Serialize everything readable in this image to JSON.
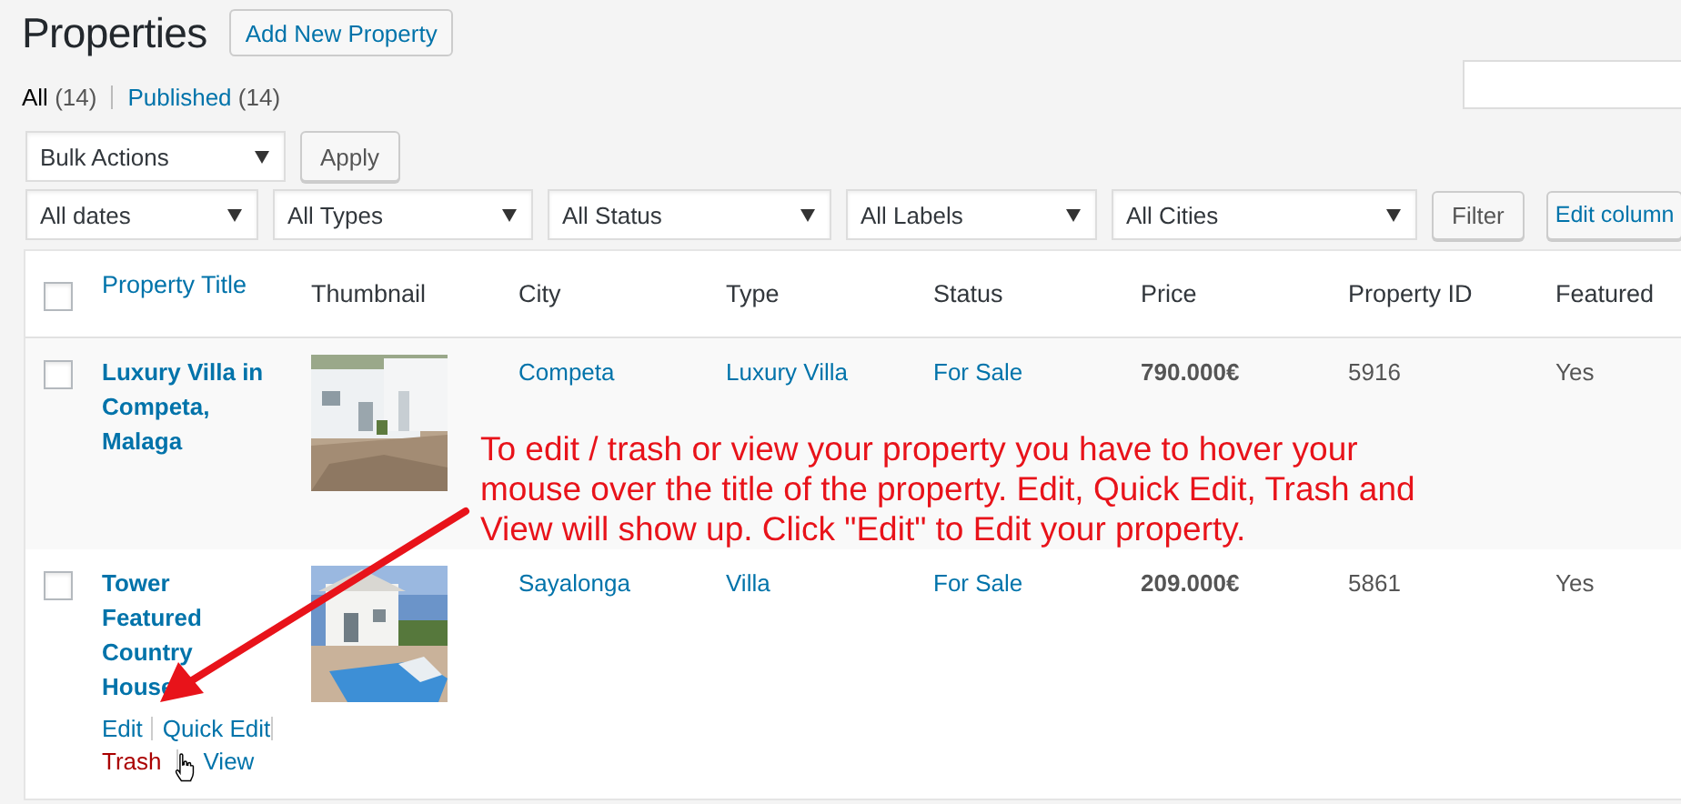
{
  "page": {
    "title": "Properties",
    "add_button": "Add New Property"
  },
  "views": [
    {
      "label": "All",
      "count": "(14)",
      "selected": true
    },
    {
      "label": "Published",
      "count": "(14)",
      "selected": false
    }
  ],
  "bulk_actions": {
    "value": "Bulk Actions",
    "button": "Apply"
  },
  "filters": [
    "All dates",
    "All Types",
    "All Status",
    "All Labels",
    "All Cities"
  ],
  "filter_button": "Filter",
  "edit_columns_button": "Edit column",
  "table": {
    "select_all": {
      "checked": false
    },
    "columns": [
      {
        "label": "Property Title",
        "kind": "link"
      },
      {
        "label": "Thumbnail",
        "kind": "plain"
      },
      {
        "label": "City",
        "kind": "plain"
      },
      {
        "label": "Type",
        "kind": "plain"
      },
      {
        "label": "Status",
        "kind": "plain"
      },
      {
        "label": "Price",
        "kind": "plain"
      },
      {
        "label": "Property ID",
        "kind": "plain"
      },
      {
        "label": "Featured",
        "kind": "plain"
      }
    ],
    "rows": [
      {
        "checked": false,
        "title": "Luxury Villa in Competa, Malaga",
        "thumbnail": {
          "kind": "picture"
        },
        "city": "Competa",
        "type": "Luxury Villa",
        "status": "For Sale",
        "price": "790.000€",
        "property_id": "5916",
        "featured": "Yes",
        "actions": []
      },
      {
        "checked": false,
        "title": "Tower Featured Country House",
        "thumbnail": {
          "kind": "picture"
        },
        "city": "Sayalonga",
        "type": "Villa",
        "status": "For Sale",
        "price": "209.000€",
        "property_id": "5861",
        "featured": "Yes",
        "actions": [
          {
            "label": "Edit",
            "kind": "normal"
          },
          {
            "label": "Quick Edit",
            "kind": "normal"
          },
          {
            "label": "Trash",
            "kind": "danger"
          },
          {
            "label": "View",
            "kind": "normal"
          }
        ]
      }
    ]
  },
  "annotation": {
    "lines": [
      "To edit / trash or view your property you have to hover your",
      "mouse over the title of the property. Edit, Quick Edit, Trash and",
      "View will show up. Click \"Edit\" to Edit your property."
    ]
  }
}
